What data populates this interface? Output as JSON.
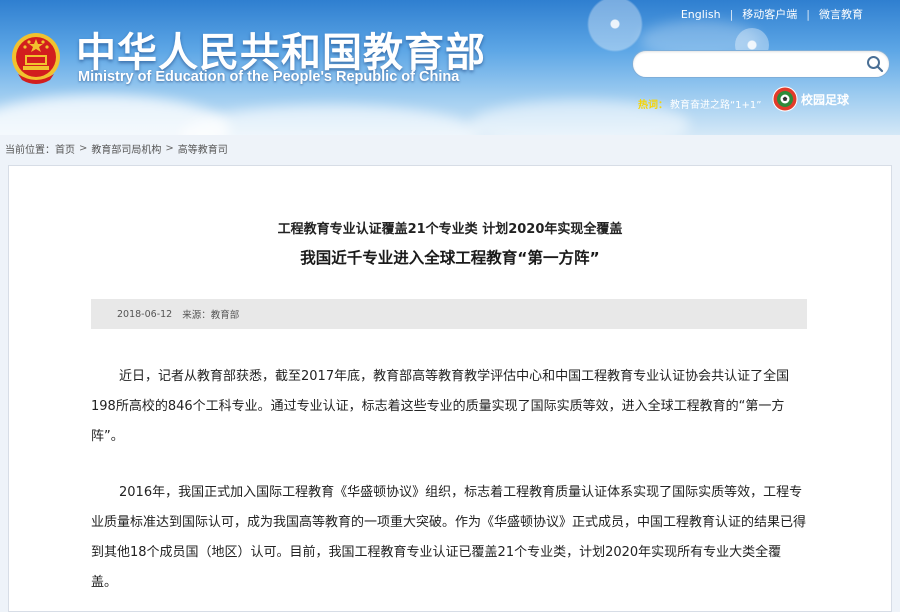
{
  "header": {
    "title": "中华人民共和国教育部",
    "subtitle": "Ministry of Education of the People's Republic of China",
    "links": [
      "English",
      "移动客户端",
      "微言教育"
    ],
    "search": {
      "placeholder": "",
      "value": ""
    },
    "hot": {
      "label": "热词：",
      "text": "教育奋进之路“1+1”"
    },
    "campus_label": "校园足球"
  },
  "breadcrumb": {
    "label": "当前位置：",
    "items": [
      "首页",
      "教育部司局机构",
      "高等教育司"
    ]
  },
  "article": {
    "subtitle": "工程教育专业认证覆盖21个专业类 计划2020年实现全覆盖",
    "title": "我国近千专业进入全球工程教育“第一方阵”",
    "date": "2018-06-12",
    "source": "来源：教育部",
    "paragraphs": [
      "近日，记者从教育部获悉，截至2017年底，教育部高等教育教学评估中心和中国工程教育专业认证协会共认证了全国198所高校的846个工科专业。通过专业认证，标志着这些专业的质量实现了国际实质等效，进入全球工程教育的“第一方阵”。",
      "2016年，我国正式加入国际工程教育《华盛顿协议》组织，标志着工程教育质量认证体系实现了国际实质等效，工程专业质量标准达到国际认可，成为我国高等教育的一项重大突破。作为《华盛顿协议》正式成员，中国工程教育认证的结果已得到其他18个成员国（地区）认可。目前，我国工程教育专业认证已覆盖21个专业类，计划2020年实现所有专业大类全覆盖。"
    ]
  },
  "colors": {
    "header_blue": "#2f7fd0",
    "hot_yellow": "#f5d40a",
    "emblem_red": "#d21e1e",
    "emblem_gold": "#f2c22e"
  }
}
